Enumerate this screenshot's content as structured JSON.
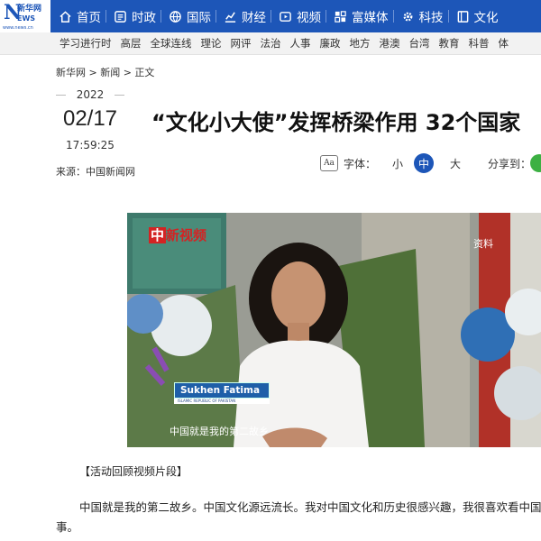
{
  "logo": {
    "big": "N",
    "cn": "新华网",
    "ews": "EWS",
    "url": "www.news.cn"
  },
  "nav": [
    {
      "label": "首页",
      "icon": "home-icon"
    },
    {
      "label": "时政",
      "icon": "government-icon"
    },
    {
      "label": "国际",
      "icon": "globe-icon"
    },
    {
      "label": "财经",
      "icon": "chart-icon"
    },
    {
      "label": "视频",
      "icon": "video-icon"
    },
    {
      "label": "富媒体",
      "icon": "media-grid-icon"
    },
    {
      "label": "科技",
      "icon": "gear-icon"
    },
    {
      "label": "文化",
      "icon": "book-icon"
    }
  ],
  "subnav": [
    "学习进行时",
    "高层",
    "全球连线",
    "理论",
    "网评",
    "法治",
    "人事",
    "廉政",
    "地方",
    "港澳",
    "台湾",
    "教育",
    "科普",
    "体"
  ],
  "breadcrumb": "新华网 > 新闻 > 正文",
  "date": {
    "year": "2022",
    "monthday": "02/17",
    "time": "17:59:25"
  },
  "headline": "“文化小大使”发挥桥梁作用 32个国家",
  "source": "来源：中国新闻网",
  "font_control": {
    "icon_text": "Aa",
    "label": "字体：",
    "small": "小",
    "medium": "中",
    "large": "大"
  },
  "share_label": "分享到：",
  "video": {
    "logo_prefix": "中",
    "logo_text": "新视频",
    "corner_tag": "资料",
    "name": "Sukhen Fatima",
    "name_sub": "ISLAMIC REPUBLIC OF PAKISTAN",
    "subtitle": "中国就是我的第二故乡"
  },
  "caption": "【活动回顾视频片段】",
  "paragraph": "中国就是我的第二故乡。中国文化源远流长。我对中国文化和历史很感兴趣，我很喜欢看中国故事。",
  "colors": {
    "nav_blue": "#1d56b8",
    "accent_red": "#d42323",
    "share_green": "#3cb043"
  }
}
